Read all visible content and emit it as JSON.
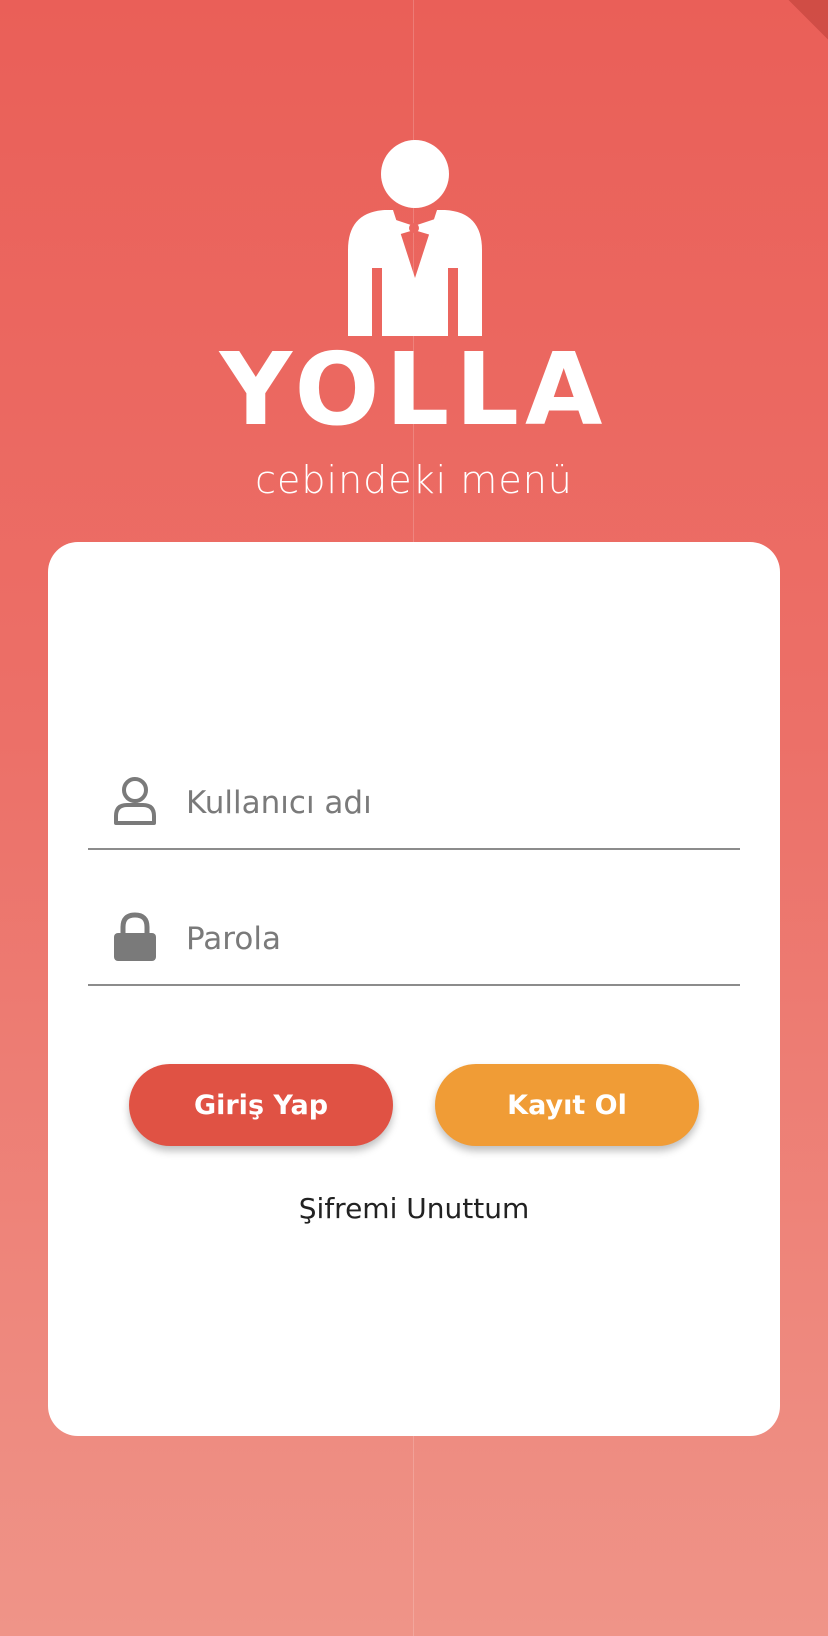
{
  "app": {
    "brand": "YOLLA",
    "tagline": "cebindeki menü"
  },
  "login": {
    "username": {
      "placeholder": "Kullanıcı adı",
      "value": "",
      "icon": "user-icon"
    },
    "password": {
      "placeholder": "Parola",
      "value": "",
      "icon": "lock-icon"
    },
    "login_button": "Giriş Yap",
    "register_button": "Kayıt Ol",
    "forgot_password": "Şifremi Unuttum"
  },
  "colors": {
    "background_top": "#ea5f58",
    "background_bottom": "#ef9488",
    "login_button": "#e05244",
    "register_button": "#f09c36",
    "card": "#ffffff"
  }
}
